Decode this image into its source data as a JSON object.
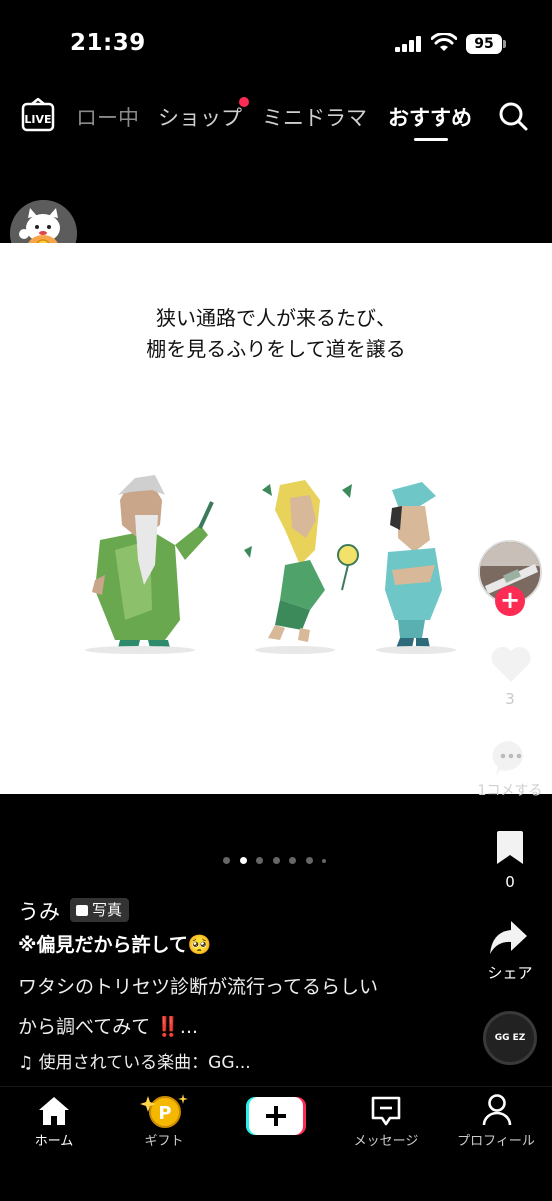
{
  "status_bar": {
    "time": "21:39",
    "battery": "95"
  },
  "top_nav": {
    "live_label": "LIVE",
    "tabs": [
      {
        "label": "ロー中"
      },
      {
        "label": "ショップ"
      },
      {
        "label": "ミニドラマ"
      },
      {
        "label": "おすすめ"
      }
    ],
    "active_tab": "おすすめ"
  },
  "post": {
    "caption_lines": [
      "狭い通路で人が来るたび、",
      "棚を見るふりをして道を譲る"
    ],
    "page_count": 7,
    "active_page": 2,
    "username": "うみ",
    "badge": "写真",
    "title": "※偏見だから許して🥺",
    "description_lines": [
      "ワタシのトリセツ診断が流行ってるらしい",
      "から調べてみて ‼️..."
    ],
    "music": "使用されている楽曲：GG..."
  },
  "side_rail": {
    "like_count": "3",
    "comment_label": "1コメする",
    "bookmark_count": "0",
    "share_label": "シェア",
    "disc_label": "GG EZ"
  },
  "bottom_nav": {
    "home": "ホーム",
    "gift": "ギフト",
    "messages": "メッセージ",
    "profile": "プロフィール"
  },
  "colors": {
    "accent": "#fe2c55",
    "background": "#000000"
  }
}
